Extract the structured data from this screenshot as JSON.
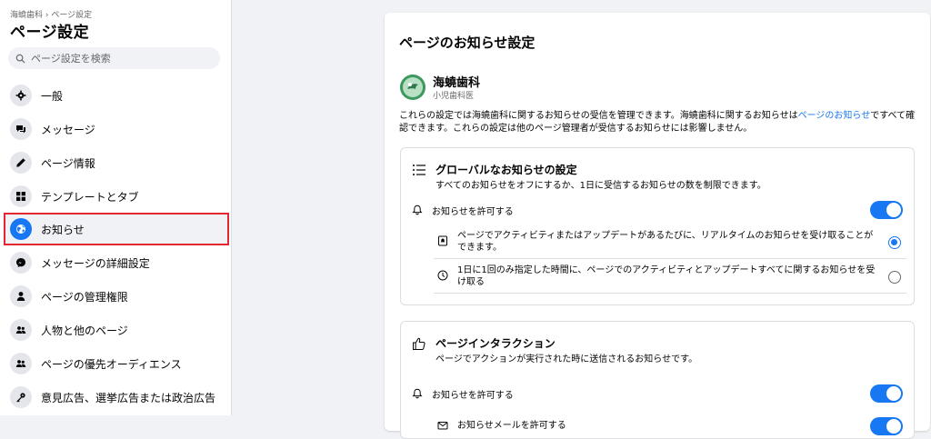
{
  "sidebar": {
    "breadcrumb": "海蟯歯科 › ページ設定",
    "title": "ページ設定",
    "search_placeholder": "ページ設定を検索",
    "items": [
      {
        "label": "一般",
        "icon": "gear-icon"
      },
      {
        "label": "メッセージ",
        "icon": "chat-bubbles-icon"
      },
      {
        "label": "ページ情報",
        "icon": "pencil-icon"
      },
      {
        "label": "テンプレートとタブ",
        "icon": "grid-icon"
      },
      {
        "label": "お知らせ",
        "icon": "globe-icon"
      },
      {
        "label": "メッセージの詳細設定",
        "icon": "messenger-icon"
      },
      {
        "label": "ページの管理権限",
        "icon": "person-icon"
      },
      {
        "label": "人物と他のページ",
        "icon": "people-icon"
      },
      {
        "label": "ページの優先オーディエンス",
        "icon": "people-icon"
      },
      {
        "label": "意見広告、選挙広告または政治広告",
        "icon": "key-icon"
      }
    ],
    "active_index": 4,
    "highlight_color": "#e3262f"
  },
  "main": {
    "title": "ページのお知らせ設定",
    "page": {
      "name": "海蟯歯科",
      "category": "小児歯科医"
    },
    "intro": {
      "text_before": "これらの設定では海蟯歯科に関するお知らせの受信を管理できます。海蟯歯科に関するお知らせは",
      "link": "ページのお知らせ",
      "text_after": "ですべて確認できます。これらの設定は他のページ管理者が受信するお知らせには影響しません。"
    },
    "global_section": {
      "title": "グローバルなお知らせの設定",
      "description": "すべてのお知らせをオフにするか、1日に受信するお知らせの数を制限できます。",
      "allow_label": "お知らせを許可する",
      "allow_on": true,
      "options": [
        {
          "text": "ページでアクティビティまたはアップデートがあるたびに、リアルタイムのお知らせを受け取ることができます。",
          "icon": "realtime-icon",
          "selected": true
        },
        {
          "text": "1日に1回のみ指定した時間に、ページでのアクティビティとアップデートすべてに関するお知らせを受け取る",
          "icon": "clock-icon",
          "selected": false
        }
      ]
    },
    "interaction_section": {
      "title": "ページインタラクション",
      "description": "ページでアクションが実行された時に送信されるお知らせです。",
      "allow_label": "お知らせを許可する",
      "allow_on": true,
      "email_label": "お知らせメールを許可する",
      "email_on": true
    }
  },
  "colors": {
    "accent": "#1877f2",
    "background": "#f0f2f5",
    "avatar": "#3c9a5f"
  }
}
